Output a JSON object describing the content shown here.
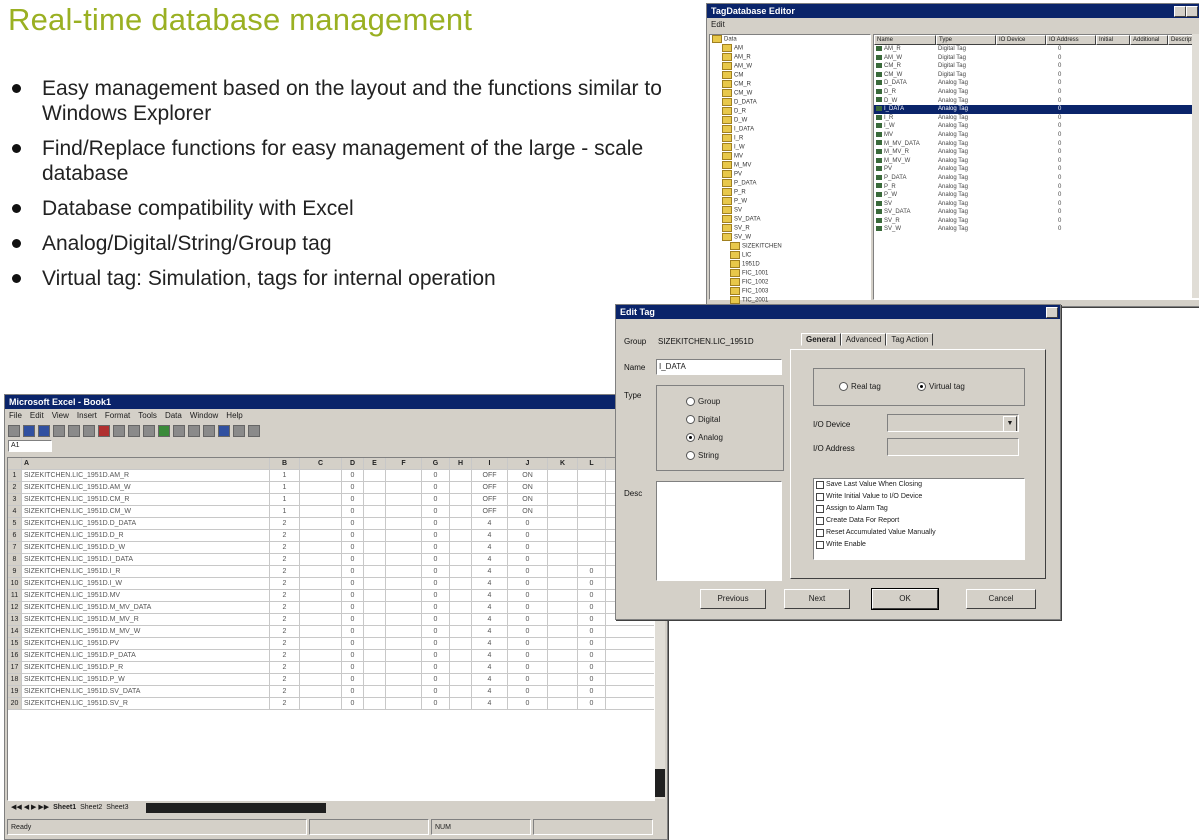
{
  "slide": {
    "title": "Real-time database management",
    "bullets": [
      "Easy management based on the layout and the functions similar to Windows Explorer",
      "Find/Replace functions for easy management of the large - scale database",
      "Database compatibility with Excel",
      "Analog/Digital/String/Group tag",
      "Virtual tag: Simulation, tags for internal operation"
    ]
  },
  "excel": {
    "title": "Microsoft Excel - Book1",
    "menu": [
      "File",
      "Edit",
      "View",
      "Insert",
      "Format",
      "Tools",
      "Data",
      "Window",
      "Help"
    ],
    "name_box": "A1",
    "columns": [
      "",
      "A",
      "B",
      "C",
      "D",
      "E",
      "F",
      "G",
      "H",
      "I",
      "J",
      "K",
      "L"
    ],
    "rows": [
      [
        "1",
        "SIZEKITCHEN.LIC_1951D.AM_R",
        "1",
        "",
        "0",
        "",
        "",
        "0",
        "",
        "OFF",
        "ON",
        "",
        ""
      ],
      [
        "2",
        "SIZEKITCHEN.LIC_1951D.AM_W",
        "1",
        "",
        "0",
        "",
        "",
        "0",
        "",
        "OFF",
        "ON",
        "",
        ""
      ],
      [
        "3",
        "SIZEKITCHEN.LIC_1951D.CM_R",
        "1",
        "",
        "0",
        "",
        "",
        "0",
        "",
        "OFF",
        "ON",
        "",
        ""
      ],
      [
        "4",
        "SIZEKITCHEN.LIC_1951D.CM_W",
        "1",
        "",
        "0",
        "",
        "",
        "0",
        "",
        "OFF",
        "ON",
        "",
        ""
      ],
      [
        "5",
        "SIZEKITCHEN.LIC_1951D.D_DATA",
        "2",
        "",
        "0",
        "",
        "",
        "0",
        "",
        "4",
        "0",
        "",
        ""
      ],
      [
        "6",
        "SIZEKITCHEN.LIC_1951D.D_R",
        "2",
        "",
        "0",
        "",
        "",
        "0",
        "",
        "4",
        "0",
        "",
        ""
      ],
      [
        "7",
        "SIZEKITCHEN.LIC_1951D.D_W",
        "2",
        "",
        "0",
        "",
        "",
        "0",
        "",
        "4",
        "0",
        "",
        ""
      ],
      [
        "8",
        "SIZEKITCHEN.LIC_1951D.I_DATA",
        "2",
        "",
        "0",
        "",
        "",
        "0",
        "",
        "4",
        "0",
        "",
        ""
      ],
      [
        "9",
        "SIZEKITCHEN.LIC_1951D.I_R",
        "2",
        "",
        "0",
        "",
        "",
        "0",
        "",
        "4",
        "0",
        "",
        "0"
      ],
      [
        "10",
        "SIZEKITCHEN.LIC_1951D.I_W",
        "2",
        "",
        "0",
        "",
        "",
        "0",
        "",
        "4",
        "0",
        "",
        "0"
      ],
      [
        "11",
        "SIZEKITCHEN.LIC_1951D.MV",
        "2",
        "",
        "0",
        "",
        "",
        "0",
        "",
        "4",
        "0",
        "",
        "0"
      ],
      [
        "12",
        "SIZEKITCHEN.LIC_1951D.M_MV_DATA",
        "2",
        "",
        "0",
        "",
        "",
        "0",
        "",
        "4",
        "0",
        "",
        "0"
      ],
      [
        "13",
        "SIZEKITCHEN.LIC_1951D.M_MV_R",
        "2",
        "",
        "0",
        "",
        "",
        "0",
        "",
        "4",
        "0",
        "",
        "0"
      ],
      [
        "14",
        "SIZEKITCHEN.LIC_1951D.M_MV_W",
        "2",
        "",
        "0",
        "",
        "",
        "0",
        "",
        "4",
        "0",
        "",
        "0"
      ],
      [
        "15",
        "SIZEKITCHEN.LIC_1951D.PV",
        "2",
        "",
        "0",
        "",
        "",
        "0",
        "",
        "4",
        "0",
        "",
        "0"
      ],
      [
        "16",
        "SIZEKITCHEN.LIC_1951D.P_DATA",
        "2",
        "",
        "0",
        "",
        "",
        "0",
        "",
        "4",
        "0",
        "",
        "0"
      ],
      [
        "17",
        "SIZEKITCHEN.LIC_1951D.P_R",
        "2",
        "",
        "0",
        "",
        "",
        "0",
        "",
        "4",
        "0",
        "",
        "0"
      ],
      [
        "18",
        "SIZEKITCHEN.LIC_1951D.P_W",
        "2",
        "",
        "0",
        "",
        "",
        "0",
        "",
        "4",
        "0",
        "",
        "0"
      ],
      [
        "19",
        "SIZEKITCHEN.LIC_1951D.SV_DATA",
        "2",
        "",
        "0",
        "",
        "",
        "0",
        "",
        "4",
        "0",
        "",
        "0"
      ],
      [
        "20",
        "SIZEKITCHEN.LIC_1951D.SV_R",
        "2",
        "",
        "0",
        "",
        "",
        "0",
        "",
        "4",
        "0",
        "",
        "0"
      ]
    ],
    "sheet_tabs": [
      "Sheet1",
      "Sheet2",
      "Sheet3"
    ],
    "status": "Ready",
    "status_right": "NUM"
  },
  "explorer": {
    "title": "TagDatabase Editor",
    "menu": [
      "Edit"
    ],
    "tree": [
      "Data",
      "AM",
      "AM_R",
      "AM_W",
      "CM",
      "CM_R",
      "CM_W",
      "D_DATA",
      "D_R",
      "D_W",
      "I_DATA",
      "I_R",
      "I_W",
      "MV",
      "M_MV",
      "PV",
      "P_DATA",
      "P_R",
      "P_W",
      "SV",
      "SV_DATA",
      "SV_R",
      "SV_W",
      "SIZEKITCHEN",
      "LIC",
      "1951D",
      "FIC_1001",
      "FIC_1002",
      "FIC_1003",
      "TIC_2001",
      "TIC_2002",
      "PIC_3001"
    ],
    "columns": [
      "Name",
      "Type",
      "IO Device",
      "IO Address",
      "Initial",
      "Additional",
      "Description"
    ],
    "rows": [
      {
        "name": "AM_R",
        "type": "Digital Tag",
        "init": "0",
        "selected": false
      },
      {
        "name": "AM_W",
        "type": "Digital Tag",
        "init": "0",
        "selected": false
      },
      {
        "name": "CM_R",
        "type": "Digital Tag",
        "init": "0",
        "selected": false
      },
      {
        "name": "CM_W",
        "type": "Digital Tag",
        "init": "0",
        "selected": false
      },
      {
        "name": "D_DATA",
        "type": "Analog Tag",
        "init": "0",
        "selected": false
      },
      {
        "name": "D_R",
        "type": "Analog Tag",
        "init": "0",
        "selected": false
      },
      {
        "name": "D_W",
        "type": "Analog Tag",
        "init": "0",
        "selected": false
      },
      {
        "name": "I_DATA",
        "type": "Analog Tag",
        "init": "0",
        "selected": true
      },
      {
        "name": "I_R",
        "type": "Analog Tag",
        "init": "0",
        "selected": false
      },
      {
        "name": "I_W",
        "type": "Analog Tag",
        "init": "0",
        "selected": false
      },
      {
        "name": "MV",
        "type": "Analog Tag",
        "init": "0",
        "selected": false
      },
      {
        "name": "M_MV_DATA",
        "type": "Analog Tag",
        "init": "0",
        "selected": false
      },
      {
        "name": "M_MV_R",
        "type": "Analog Tag",
        "init": "0",
        "selected": false
      },
      {
        "name": "M_MV_W",
        "type": "Analog Tag",
        "init": "0",
        "selected": false
      },
      {
        "name": "PV",
        "type": "Analog Tag",
        "init": "0",
        "selected": false
      },
      {
        "name": "P_DATA",
        "type": "Analog Tag",
        "init": "0",
        "selected": false
      },
      {
        "name": "P_R",
        "type": "Analog Tag",
        "init": "0",
        "selected": false
      },
      {
        "name": "P_W",
        "type": "Analog Tag",
        "init": "0",
        "selected": false
      },
      {
        "name": "SV",
        "type": "Analog Tag",
        "init": "0",
        "selected": false
      },
      {
        "name": "SV_DATA",
        "type": "Analog Tag",
        "init": "0",
        "selected": false
      },
      {
        "name": "SV_R",
        "type": "Analog Tag",
        "init": "0",
        "selected": false
      },
      {
        "name": "SV_W",
        "type": "Analog Tag",
        "init": "0",
        "selected": false
      }
    ]
  },
  "edit_tag": {
    "title": "Edit Tag",
    "group_label": "Group",
    "group_value": "SIZEKITCHEN.LIC_1951D",
    "name_label": "Name",
    "name_value": "I_DATA",
    "type_label": "Type",
    "types": [
      "Group",
      "Digital",
      "Analog",
      "String"
    ],
    "selected_type": "Analog",
    "desc_label": "Desc",
    "tabs": [
      "General",
      "Advanced",
      "Tag Action"
    ],
    "real_tag": "Real tag",
    "virtual_tag": "Virtual tag",
    "io_device_label": "I/O Device",
    "io_address_label": "I/O Address",
    "options": [
      "Save Last Value When Closing",
      "Write Initial Value to I/O Device",
      "Assign to Alarm Tag",
      "Create Data For Report",
      "Reset Accumulated Value Manually",
      "Write Enable"
    ],
    "buttons": {
      "previous": "Previous",
      "next": "Next",
      "ok": "OK",
      "cancel": "Cancel"
    }
  }
}
